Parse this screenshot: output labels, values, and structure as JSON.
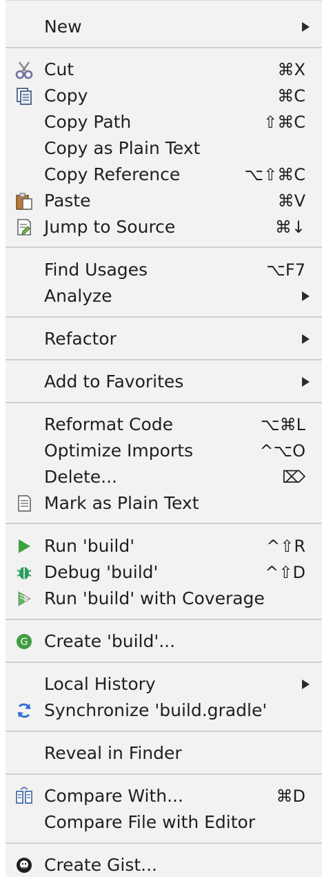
{
  "menu": {
    "items": [
      {
        "label": "New",
        "shortcut": "",
        "submenu": true
      },
      {
        "label": "Cut",
        "shortcut": "⌘X",
        "submenu": false,
        "icon": "scissors-icon"
      },
      {
        "label": "Copy",
        "shortcut": "⌘C",
        "submenu": false,
        "icon": "copy-icon"
      },
      {
        "label": "Copy Path",
        "shortcut": "⇧⌘C",
        "submenu": false
      },
      {
        "label": "Copy as Plain Text",
        "shortcut": "",
        "submenu": false
      },
      {
        "label": "Copy Reference",
        "shortcut": "⌥⇧⌘C",
        "submenu": false
      },
      {
        "label": "Paste",
        "shortcut": "⌘V",
        "submenu": false,
        "icon": "paste-icon"
      },
      {
        "label": "Jump to Source",
        "shortcut": "⌘↓",
        "submenu": false,
        "icon": "jump-to-source-icon"
      },
      {
        "label": "Find Usages",
        "shortcut": "⌥F7",
        "submenu": false
      },
      {
        "label": "Analyze",
        "shortcut": "",
        "submenu": true
      },
      {
        "label": "Refactor",
        "shortcut": "",
        "submenu": true
      },
      {
        "label": "Add to Favorites",
        "shortcut": "",
        "submenu": true
      },
      {
        "label": "Reformat Code",
        "shortcut": "⌥⌘L",
        "submenu": false
      },
      {
        "label": "Optimize Imports",
        "shortcut": "^⌥O",
        "submenu": false
      },
      {
        "label": "Delete...",
        "shortcut": "⌦",
        "submenu": false
      },
      {
        "label": "Mark as Plain Text",
        "shortcut": "",
        "submenu": false,
        "icon": "document-icon"
      },
      {
        "label": "Run 'build'",
        "shortcut": "^⇧R",
        "submenu": false,
        "icon": "run-icon"
      },
      {
        "label": "Debug 'build'",
        "shortcut": "^⇧D",
        "submenu": false,
        "icon": "debug-icon"
      },
      {
        "label": "Run 'build' with Coverage",
        "shortcut": "",
        "submenu": false,
        "icon": "coverage-icon"
      },
      {
        "label": "Create 'build'...",
        "shortcut": "",
        "submenu": false,
        "icon": "gradle-icon"
      },
      {
        "label": "Local History",
        "shortcut": "",
        "submenu": true
      },
      {
        "label": "Synchronize 'build.gradle'",
        "shortcut": "",
        "submenu": false,
        "icon": "sync-icon"
      },
      {
        "label": "Reveal in Finder",
        "shortcut": "",
        "submenu": false
      },
      {
        "label": "Compare With...",
        "shortcut": "⌘D",
        "submenu": false,
        "icon": "compare-icon"
      },
      {
        "label": "Compare File with Editor",
        "shortcut": "",
        "submenu": false
      },
      {
        "label": "Create Gist...",
        "shortcut": "",
        "submenu": false,
        "icon": "github-icon"
      }
    ]
  },
  "colors": {
    "background": "#f2f2f2",
    "separator": "#cfcfcf",
    "text": "#1f1f1f",
    "run_green": "#3aa33a",
    "debug_green": "#2a9d5f",
    "sync_blue": "#2f6fd6",
    "gradle_green": "#3f9b3f"
  }
}
